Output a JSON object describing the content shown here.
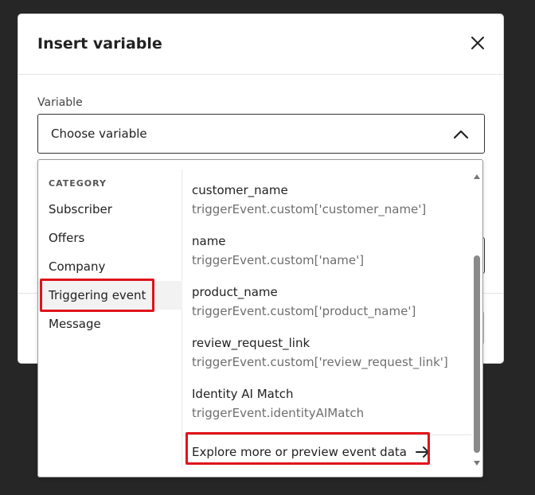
{
  "modal": {
    "title": "Insert variable",
    "variable_label": "Variable",
    "select_value": "Choose variable"
  },
  "dropdown": {
    "category_heading": "CATEGORY",
    "categories": [
      {
        "label": "Subscriber"
      },
      {
        "label": "Offers"
      },
      {
        "label": "Company"
      },
      {
        "label": "Triggering event",
        "selected": true
      },
      {
        "label": "Message"
      }
    ],
    "variables": [
      {
        "name": "customer_name",
        "path": "triggerEvent.custom['customer_name']"
      },
      {
        "name": "name",
        "path": "triggerEvent.custom['name']"
      },
      {
        "name": "product_name",
        "path": "triggerEvent.custom['product_name']"
      },
      {
        "name": "review_request_link",
        "path": "triggerEvent.custom['review_request_link']"
      },
      {
        "name": "Identity AI Match",
        "path": "triggerEvent.identityAIMatch"
      }
    ],
    "explore_link": "Explore more or preview event data"
  },
  "colors": {
    "highlight": "#e0131b",
    "background": "#262626",
    "selected_category_bg": "#f2f2f2"
  },
  "icons": {
    "close": "close-icon",
    "chevron": "chevron-up-icon",
    "arrow": "arrow-right-icon"
  }
}
